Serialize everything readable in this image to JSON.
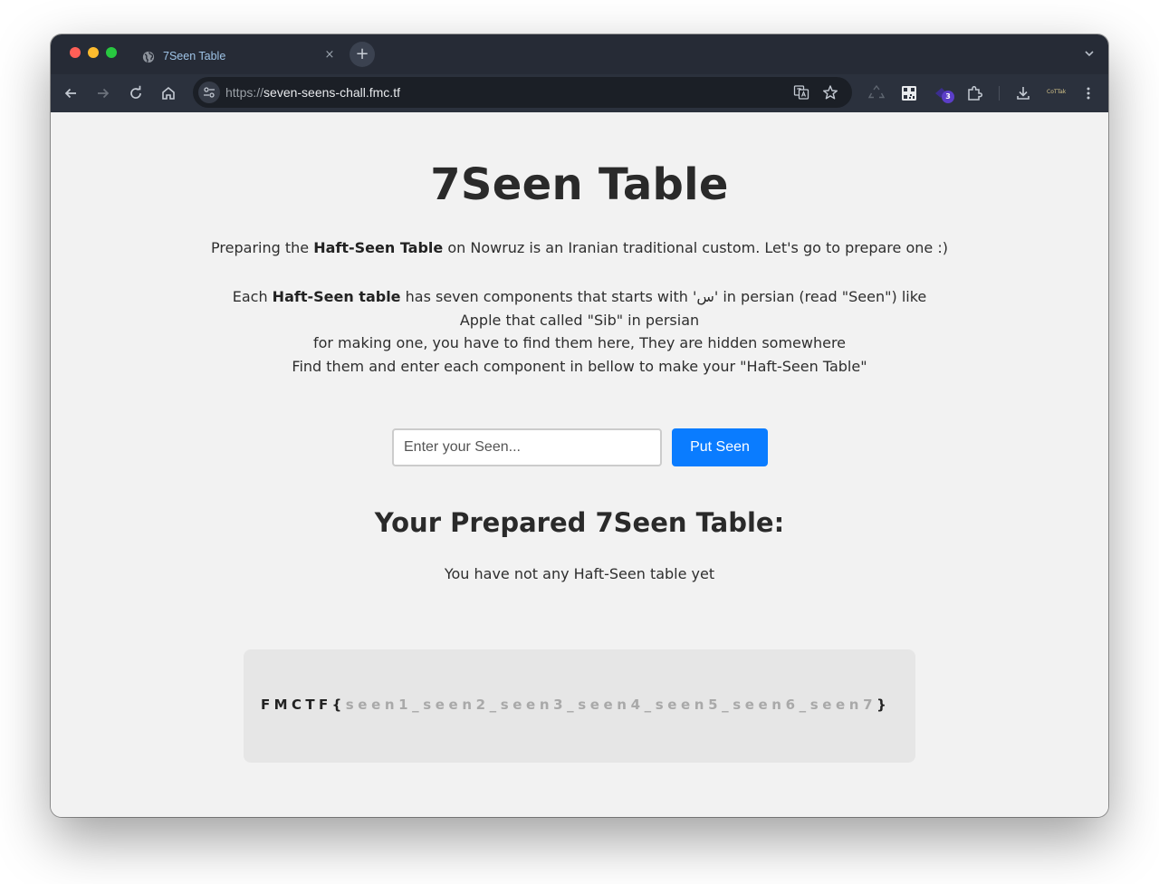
{
  "browser": {
    "tab_title": "7Seen Table",
    "tab_close_glyph": "×",
    "new_tab_glyph": "+",
    "url_scheme": "https://",
    "url_host": "seven-seens-chall.fmc.tf",
    "extension_badge": "3",
    "profile_label": "CoTTak"
  },
  "page": {
    "title": "7Seen Table",
    "intro_pre": "Preparing the ",
    "intro_bold": "Haft-Seen Table",
    "intro_post": " on Nowruz is an Iranian traditional custom. Let's go to prepare one :)",
    "desc_pre": "Each ",
    "desc_bold": "Haft-Seen table",
    "desc_line1_post": " has seven components that starts with 'س' in persian (read \"Seen\") like Apple that called \"Sib\" in persian",
    "desc_line2": "for making one, you have to find them here, They are hidden somewhere",
    "desc_line3": "Find them and enter each component in bellow to make your \"Haft-Seen Table\"",
    "input_placeholder": "Enter your Seen...",
    "input_value": "",
    "button_label": "Put Seen",
    "section_title": "Your Prepared 7Seen Table:",
    "empty_message": "You have not any Haft-Seen table yet",
    "flag_prefix": "FMCTF",
    "flag_open": "{",
    "flag_body": "seen1_seen2_seen3_seen4_seen5_seen6_seen7",
    "flag_close": "}"
  },
  "colors": {
    "chrome_tabstrip": "#262b36",
    "chrome_toolbar": "#2b313d",
    "omnibox": "#1b1f26",
    "page_background": "#f2f2f2",
    "button_accent": "#0a7cff",
    "flag_box": "#e6e6e6",
    "flag_placeholder_text": "#a9a9a9"
  },
  "icons": {
    "tab_favicon": "globe-icon",
    "toolbar": [
      "back-arrow-icon",
      "forward-arrow-icon",
      "reload-icon",
      "home-icon"
    ],
    "omnibox": [
      "site-settings-icon",
      "translate-icon",
      "bookmark-star-icon"
    ],
    "extensions": [
      "recycle-icon",
      "qr-code-icon",
      "extension-badge-icon",
      "puzzle-extensions-icon",
      "download-icon",
      "profile-icon",
      "kebab-menu-icon"
    ]
  }
}
